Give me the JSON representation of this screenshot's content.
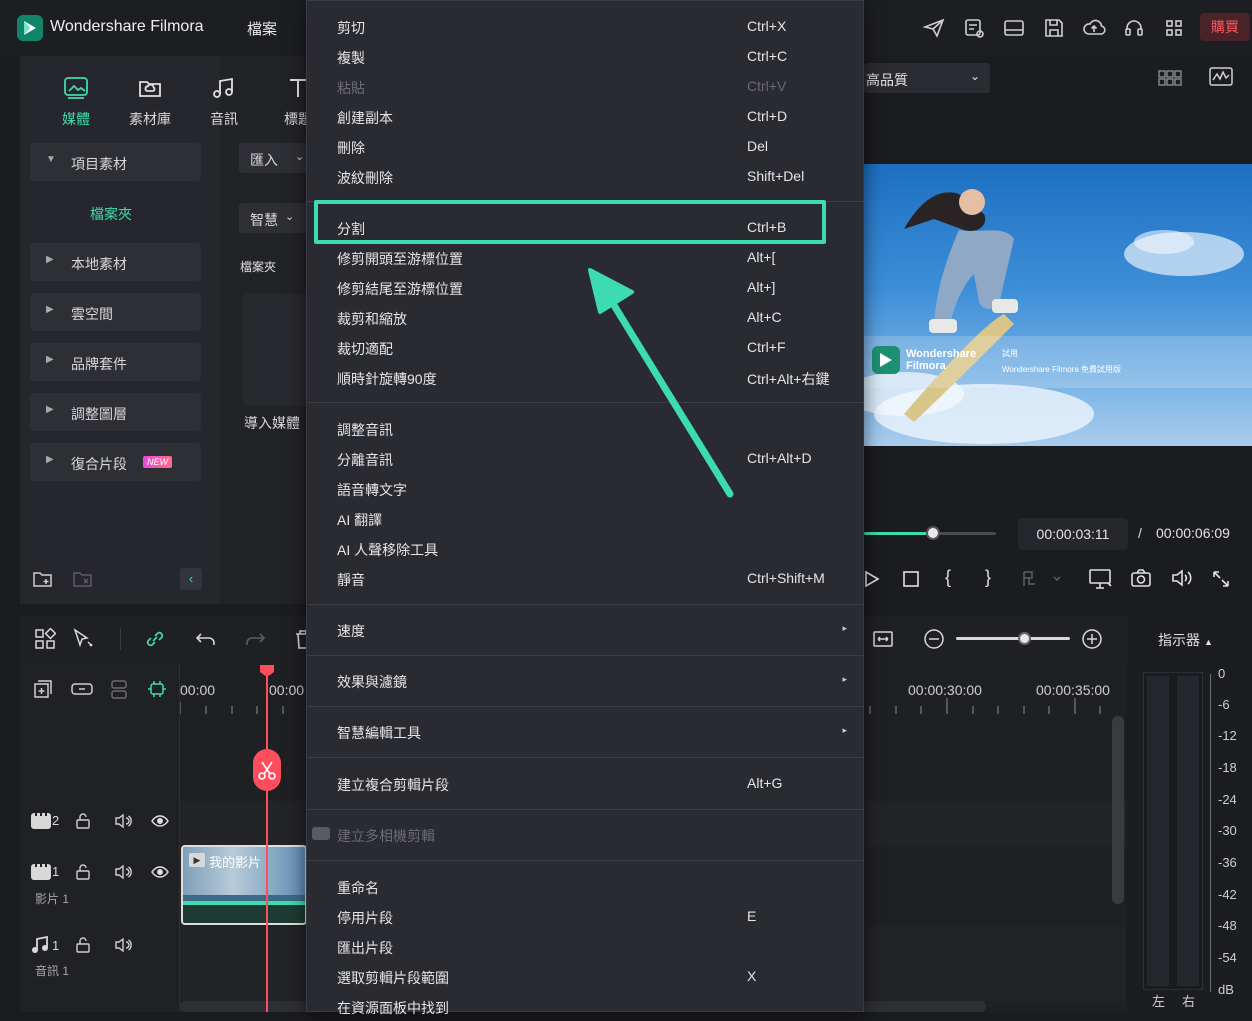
{
  "app": {
    "title": "Wondershare Filmora",
    "menu_file": "檔案",
    "buy": "購買"
  },
  "tabs": [
    {
      "label": "媒體",
      "active": true
    },
    {
      "label": "素材庫"
    },
    {
      "label": "音訊"
    },
    {
      "label": "標題"
    }
  ],
  "sidebar": {
    "project_media": "項目素材",
    "folder": "檔案夾",
    "items": [
      {
        "label": "本地素材"
      },
      {
        "label": "雲空間"
      },
      {
        "label": "品牌套件"
      },
      {
        "label": "調整圖層"
      },
      {
        "label": "復合片段",
        "badge": "NEW"
      }
    ]
  },
  "library": {
    "import": "匯入",
    "smart": "智慧",
    "folder_label": "檔案夾",
    "import_media": "導入媒體"
  },
  "preview": {
    "quality": "高品質",
    "watermark_brand": "Wondershare\nFilmora",
    "watermark_small": "試用",
    "watermark_note": "Wondershare Filmora 免費試用版",
    "current_time": "00:00:03:11",
    "separator": "/",
    "total_time": "00:00:06:09",
    "playhead_fraction": 0.52
  },
  "timeline": {
    "ruler": [
      "00:00",
      "00:00",
      "00:00:30:00",
      "00:00:35:00"
    ],
    "meter_label": "指示器",
    "tracks": [
      {
        "number": "2",
        "name": ""
      },
      {
        "number": "1",
        "name": "影片 1"
      },
      {
        "number": "1",
        "name": "音訊 1"
      }
    ],
    "clip_label": "我的影片",
    "db_scale": [
      "0",
      "-6",
      "-12",
      "-18",
      "-24",
      "-30",
      "-36",
      "-42",
      "-48",
      "-54",
      "dB"
    ],
    "channels": [
      "左",
      "右"
    ]
  },
  "context_menu": {
    "items": [
      {
        "label": "剪切",
        "shortcut": "Ctrl+X"
      },
      {
        "label": "複製",
        "shortcut": "Ctrl+C"
      },
      {
        "label": "粘貼",
        "shortcut": "Ctrl+V",
        "disabled": true
      },
      {
        "label": "創建副本",
        "shortcut": "Ctrl+D"
      },
      {
        "label": "刪除",
        "shortcut": "Del"
      },
      {
        "label": "波紋刪除",
        "shortcut": "Shift+Del"
      },
      {
        "label": "分割",
        "shortcut": "Ctrl+B",
        "highlighted": true
      },
      {
        "label": "修剪開頭至游標位置",
        "shortcut": "Alt+["
      },
      {
        "label": "修剪結尾至游標位置",
        "shortcut": "Alt+]"
      },
      {
        "label": "裁剪和縮放",
        "shortcut": "Alt+C"
      },
      {
        "label": "裁切適配",
        "shortcut": "Ctrl+F"
      },
      {
        "label": "順時針旋轉90度",
        "shortcut": "Ctrl+Alt+右鍵"
      },
      {
        "label": "調整音訊",
        "shortcut": ""
      },
      {
        "label": "分離音訊",
        "shortcut": "Ctrl+Alt+D"
      },
      {
        "label": "語音轉文字",
        "shortcut": ""
      },
      {
        "label": "AI 翻譯",
        "shortcut": ""
      },
      {
        "label": "AI 人聲移除工具",
        "shortcut": ""
      },
      {
        "label": "靜音",
        "shortcut": "Ctrl+Shift+M"
      },
      {
        "label": "速度",
        "shortcut": "",
        "submenu": true
      },
      {
        "label": "效果與濾鏡",
        "shortcut": "",
        "submenu": true
      },
      {
        "label": "智慧編輯工具",
        "shortcut": "",
        "submenu": true
      },
      {
        "label": "建立複合剪輯片段",
        "shortcut": "Alt+G"
      },
      {
        "label": "建立多相機剪輯",
        "shortcut": "",
        "disabled": true
      },
      {
        "label": "重命名",
        "shortcut": ""
      },
      {
        "label": "停用片段",
        "shortcut": "E"
      },
      {
        "label": "匯出片段",
        "shortcut": ""
      },
      {
        "label": "選取剪輯片段範圍",
        "shortcut": "X"
      },
      {
        "label": "在資源面板中找到",
        "shortcut": ""
      }
    ],
    "submenu_glyph": "▸"
  },
  "colors": {
    "accent": "#3ddbb0",
    "playhead": "#ff4d5e",
    "menu_bg": "#2a2b30"
  }
}
